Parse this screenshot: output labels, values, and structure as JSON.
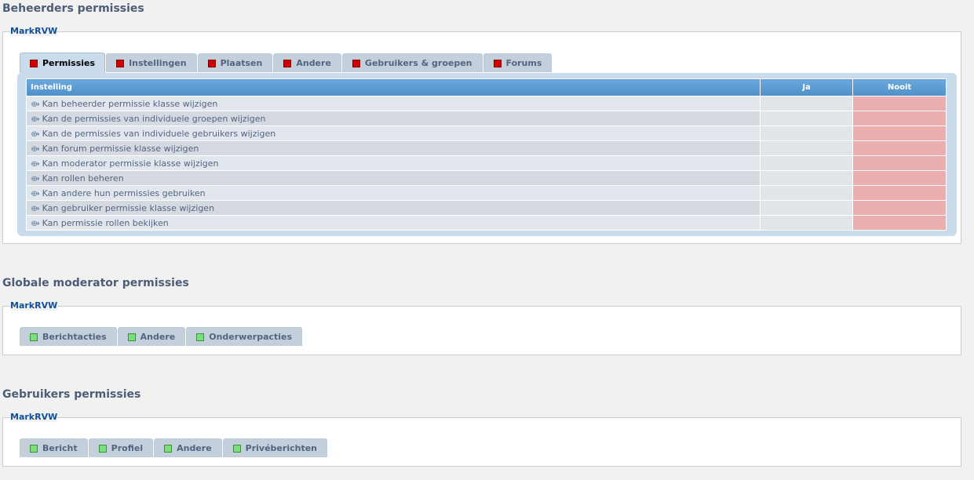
{
  "admin": {
    "title": "Beheerders permissies",
    "user": "MarkRVW",
    "tabs": [
      {
        "label": "Permissies",
        "status": "red",
        "active": true
      },
      {
        "label": "Instellingen",
        "status": "red"
      },
      {
        "label": "Plaatsen",
        "status": "red"
      },
      {
        "label": "Andere",
        "status": "red"
      },
      {
        "label": "Gebruikers & groepen",
        "status": "red"
      },
      {
        "label": "Forums",
        "status": "red"
      }
    ],
    "table": {
      "headers": [
        "Instelling",
        "Ja",
        "Nooit"
      ],
      "rows": [
        {
          "label": "Kan beheerder permissie klasse wijzigen",
          "setting": "Nooit"
        },
        {
          "label": "Kan de permissies van individuele groepen wijzigen",
          "setting": "Nooit"
        },
        {
          "label": "Kan de permissies van individuele gebruikers wijzigen",
          "setting": "Nooit"
        },
        {
          "label": "Kan forum permissie klasse wijzigen",
          "setting": "Nooit"
        },
        {
          "label": "Kan moderator permissie klasse wijzigen",
          "setting": "Nooit"
        },
        {
          "label": "Kan rollen beheren",
          "setting": "Nooit"
        },
        {
          "label": "Kan andere hun permissies gebruiken",
          "setting": "Nooit"
        },
        {
          "label": "Kan gebruiker permissie klasse wijzigen",
          "setting": "Nooit"
        },
        {
          "label": "Kan permissie rollen bekijken",
          "setting": "Nooit"
        }
      ]
    }
  },
  "moderator": {
    "title": "Globale moderator permissies",
    "user": "MarkRVW",
    "tabs": [
      {
        "label": "Berichtacties",
        "status": "green"
      },
      {
        "label": "Andere",
        "status": "green"
      },
      {
        "label": "Onderwerpacties",
        "status": "green"
      }
    ]
  },
  "users": {
    "title": "Gebruikers permissies",
    "user": "MarkRVW",
    "tabs": [
      {
        "label": "Bericht",
        "status": "green"
      },
      {
        "label": "Profiel",
        "status": "green"
      },
      {
        "label": "Andere",
        "status": "green"
      },
      {
        "label": "Privéberichten",
        "status": "green"
      }
    ]
  },
  "colors": {
    "status_red": "#d00000",
    "status_green": "#7be07b",
    "nooit_cell": "#eaaeae",
    "header_blue": "#5f9fd6",
    "title_color": "#4c5d77",
    "user_color": "#115098"
  },
  "icons": {
    "row_arrow": "arrow-right-icon"
  }
}
